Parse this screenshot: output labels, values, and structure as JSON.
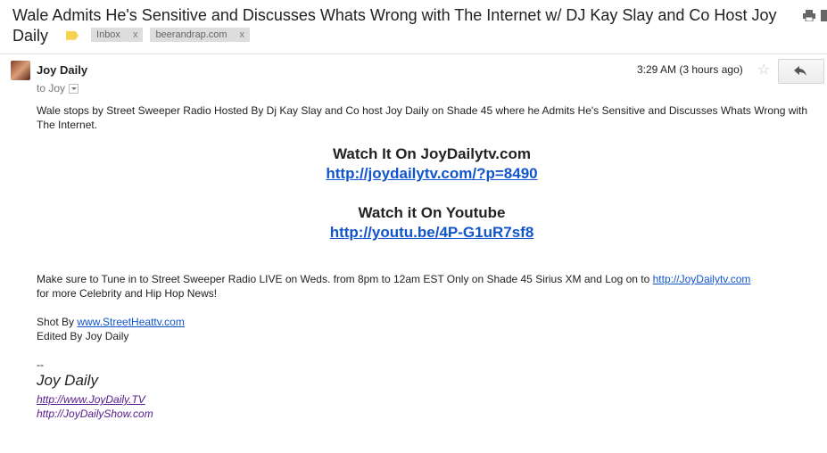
{
  "email": {
    "subject": "Wale Admits He's Sensitive and Discusses Whats Wrong with The Internet w/ DJ Kay Slay and Co Host Joy Daily",
    "labels": [
      {
        "name": "Inbox",
        "remove": "x"
      },
      {
        "name": "beerandrap.com",
        "remove": "x"
      }
    ],
    "sender": "Joy Daily",
    "to": "to Joy",
    "time": "3:29 AM (3 hours ago)",
    "star": "☆"
  },
  "body": {
    "intro": "Wale stops by Street Sweeper Radio Hosted By Dj Kay Slay and Co host Joy Daily on Shade 45 where he Admits He's Sensitive and Discusses Whats Wrong with The Internet.",
    "watch_site_heading": "Watch It On JoyDailytv.com",
    "watch_site_link": "http://joydailytv.com/?p=8490",
    "watch_youtube_heading": "Watch it On Youtube",
    "watch_youtube_link": "http://youtu.be/4P-G1uR7sf8",
    "tune_in_text": "Make sure to Tune in to Street Sweeper Radio LIVE on Weds. from 8pm to 12am EST Only on Shade 45 Sirius XM and Log on to",
    "tune_in_link": "http://JoyDailytv.com",
    "tune_in_tail": "for more Celebrity and Hip Hop News!",
    "shot_by_label": "Shot By",
    "shot_by_link": "www.StreetHeattv.com",
    "edited_by": "Edited By Joy Daily",
    "sig_separator": "--",
    "sig_name": "Joy Daily",
    "sig_link1": "http://www.JoyDaily.TV",
    "sig_link2": "http://JoyDailyShow.com"
  },
  "colors": {
    "link": "#1155cc",
    "visited": "#551a8b",
    "label": "#f6d24e"
  }
}
